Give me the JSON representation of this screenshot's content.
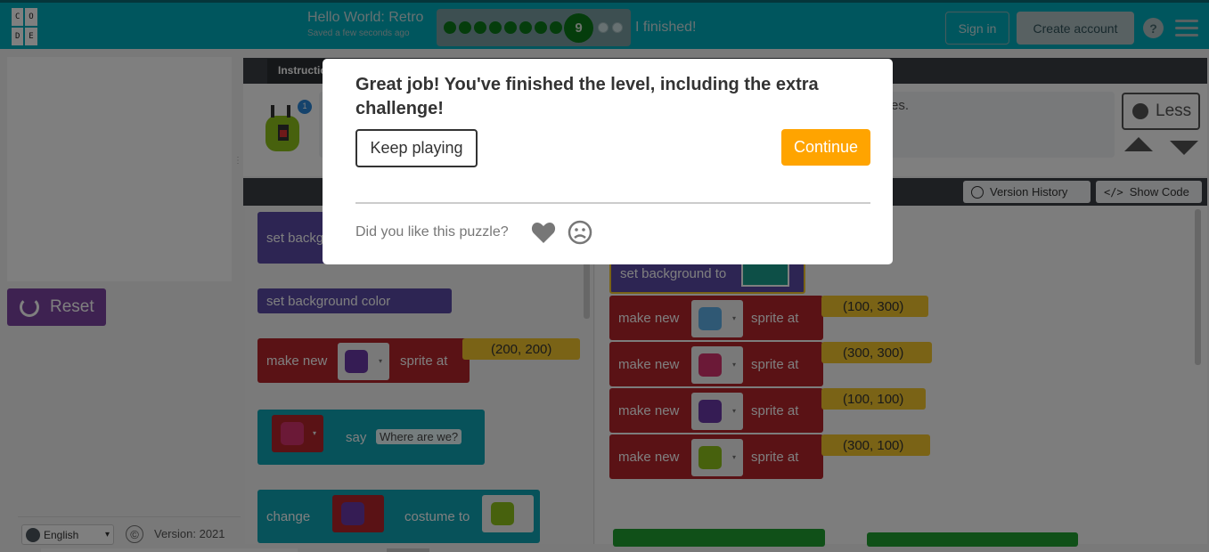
{
  "header": {
    "logo_letters": [
      "C",
      "O",
      "D",
      "E"
    ],
    "project_title": "Hello World: Retro",
    "saved_status": "Saved a few seconds ago",
    "current_level": "9",
    "completed_dots": 8,
    "remaining_dots": 2,
    "finished_label": "I finished!",
    "sign_in": "Sign in",
    "create_account": "Create account",
    "help": "?"
  },
  "left": {
    "reset_label": "Reset",
    "language": "English",
    "copyright_symbol": "©",
    "version": "Version: 2021"
  },
  "instructions": {
    "tab_label": "Instructions",
    "visible_fragment": "es.",
    "badge": "1",
    "less_label": "Less"
  },
  "workspace": {
    "version_history": "Version History",
    "show_code": "Show Code"
  },
  "toolbox_blocks": [
    {
      "label": "set backgr"
    },
    {
      "label": "set background color"
    },
    {
      "label": "make new",
      "after": "sprite at",
      "coord": "(200, 200)"
    },
    {
      "label": "say",
      "text": "Where are we?"
    },
    {
      "label": "change",
      "after": "costume to"
    }
  ],
  "program_blocks": [
    {
      "label": "set background to"
    },
    {
      "label": "make new",
      "after": "sprite at",
      "coord": "(100, 300)"
    },
    {
      "label": "make new",
      "after": "sprite at",
      "coord": "(300, 300)"
    },
    {
      "label": "make new",
      "after": "sprite at",
      "coord": "(100, 100)"
    },
    {
      "label": "make new",
      "after": "sprite at",
      "coord": "(300, 100)"
    }
  ],
  "modal": {
    "message": "Great job! You've finished the level, including the extra challenge!",
    "keep_playing": "Keep playing",
    "continue": "Continue",
    "feedback_prompt": "Did you like this puzzle?"
  },
  "colors": {
    "header": "#00adbc",
    "continue": "#ffa400",
    "reset": "#7c44a3",
    "sprite_block": "#b5242b",
    "event_block": "#5a4aa6",
    "say_block": "#0fa4b4"
  }
}
